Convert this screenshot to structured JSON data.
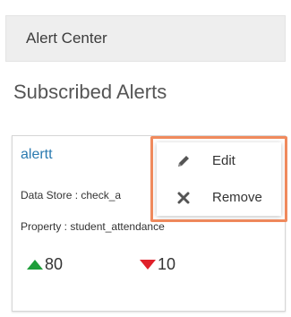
{
  "header": {
    "title": "Alert Center"
  },
  "section": {
    "title": "Subscribed Alerts"
  },
  "alert_card": {
    "name": "alertt",
    "data_store_label": "Data Store : check_a",
    "property_label": "Property : student_attendance",
    "up_value": "80",
    "down_value": "10",
    "colors": {
      "up": "#1e9e3a",
      "down": "#e0202a",
      "name": "#2a7ab0"
    }
  },
  "context_menu": {
    "items": [
      {
        "label": "Edit",
        "icon": "pencil-icon"
      },
      {
        "label": "Remove",
        "icon": "close-icon"
      }
    ],
    "highlight_color": "#f08a5d"
  }
}
